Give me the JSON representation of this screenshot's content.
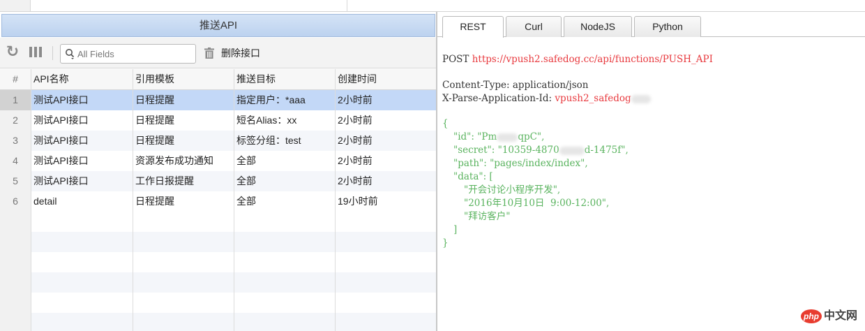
{
  "left_panel": {
    "title": "推送API",
    "search": {
      "placeholder": "All Fields",
      "value": ""
    },
    "delete_label": "删除接口",
    "columns": [
      "#",
      "API名称",
      "引用模板",
      "推送目标",
      "创建时间"
    ],
    "rows": [
      {
        "num": "1",
        "name": "测试API接口",
        "template": "日程提醒",
        "target": "指定用户：*aaa",
        "created": "2小时前"
      },
      {
        "num": "2",
        "name": "测试API接口",
        "template": "日程提醒",
        "target": "短名Alias：xx",
        "created": "2小时前"
      },
      {
        "num": "3",
        "name": "测试API接口",
        "template": "日程提醒",
        "target": "标签分组：test",
        "created": "2小时前"
      },
      {
        "num": "4",
        "name": "测试API接口",
        "template": "资源发布成功通知",
        "target": "全部",
        "created": "2小时前"
      },
      {
        "num": "5",
        "name": "测试API接口",
        "template": "工作日报提醒",
        "target": "全部",
        "created": "2小时前"
      },
      {
        "num": "6",
        "name": "detail",
        "template": "日程提醒",
        "target": "全部",
        "created": "19小时前"
      }
    ],
    "selected_row": 1
  },
  "right_panel": {
    "tabs": [
      "REST",
      "Curl",
      "NodeJS",
      "Python"
    ],
    "active_tab": "REST",
    "code": {
      "method": "POST",
      "url": "https://vpush2.safedog.cc/api/functions/PUSH_API",
      "content_type": "Content-Type: application/json",
      "app_id_label": "X-Parse-Application-Id:",
      "app_id_value": "vpush2_safedog",
      "json_open": "{",
      "id_a": "\"id\": \"Pm",
      "id_b": "qpC\",",
      "secret_a": "\"secret\": \"10359-4870",
      "secret_b": "d-1475f\",",
      "path": "\"path\": \"pages/index/index\",",
      "data_open": "\"data\": [",
      "data_1": "\"开会讨论小程序开发\",",
      "data_2": "\"2016年10月10日  9:00-12:00\",",
      "data_3": "\"拜访客户\"",
      "data_close": "]",
      "json_close": "}"
    }
  },
  "watermark": {
    "badge": "php",
    "text": "中文网"
  },
  "colors": {
    "selected_row": "#c3d8f7",
    "url_red": "#e8393e",
    "json_green": "#59b35e",
    "title_blue": "#c8dbf3"
  }
}
